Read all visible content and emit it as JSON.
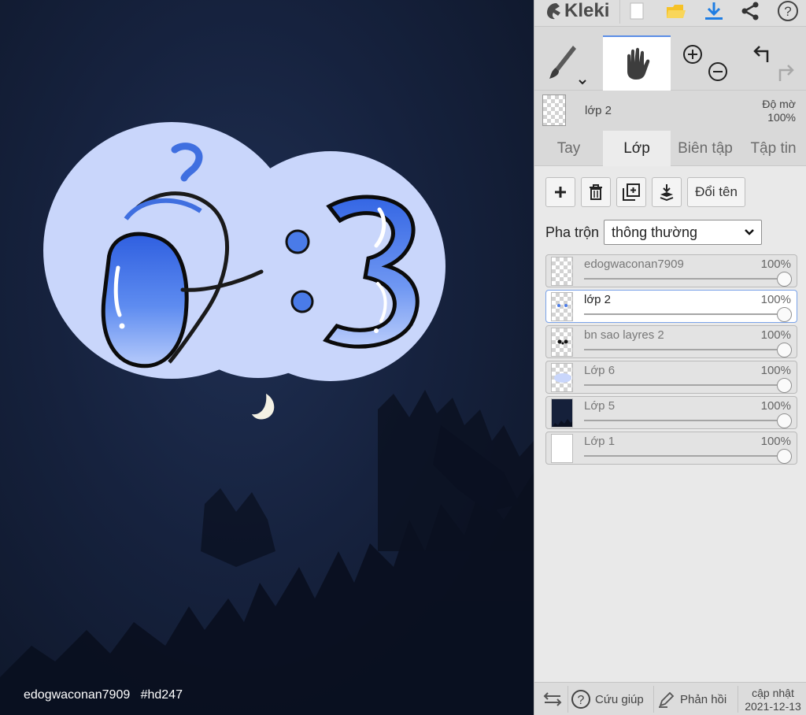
{
  "app": {
    "name": "Kleki"
  },
  "topbar": {
    "icons": [
      "new-file-icon",
      "open-folder-icon",
      "download-icon",
      "share-icon",
      "help-icon"
    ]
  },
  "tools": [
    "brush-tool-icon",
    "hand-tool-icon",
    "zoom-in-icon",
    "zoom-out-icon",
    "undo-icon",
    "redo-icon"
  ],
  "layer_info": {
    "name": "lớp 2",
    "opacity_label": "Độ mờ",
    "opacity_value": "100%"
  },
  "tabs": [
    {
      "label": "Tay",
      "active": false
    },
    {
      "label": "Lớp",
      "active": true
    },
    {
      "label": "Biên tập",
      "active": false
    },
    {
      "label": "Tập tin",
      "active": false
    }
  ],
  "layer_actions": {
    "add_icon": "plus-icon",
    "delete_icon": "trash-icon",
    "duplicate_icon": "duplicate-icon",
    "merge_icon": "merge-down-icon",
    "rename_label": "Đổi tên"
  },
  "blend": {
    "label": "Pha trộn",
    "value": "thông thường"
  },
  "layers": [
    {
      "name": "edogwaconan7909",
      "opacity": "100%",
      "opacity_value": 1.0,
      "selected": false
    },
    {
      "name": "lớp 2",
      "opacity": "100%",
      "opacity_value": 1.0,
      "selected": true
    },
    {
      "name": "bn sao layres 2",
      "opacity": "100%",
      "opacity_value": 1.0,
      "selected": false
    },
    {
      "name": "Lớp 6",
      "opacity": "100%",
      "opacity_value": 1.0,
      "selected": false
    },
    {
      "name": "Lớp 5",
      "opacity": "100%",
      "opacity_value": 1.0,
      "selected": false
    },
    {
      "name": "Lớp 1",
      "opacity": "100%",
      "opacity_value": 1.0,
      "selected": false
    }
  ],
  "footer": {
    "swap_icon": "swap-icon",
    "help_label": "Cứu giúp",
    "feedback_label": "Phản hồi",
    "update_label": "cập nhật",
    "update_date": "2021-12-13"
  },
  "canvas": {
    "watermark": "edogwaconan7909   #hd247",
    "sticker_text_left": "Ở",
    "sticker_text_right": ":3"
  },
  "colors": {
    "accent": "#5b8ee6",
    "sticker_bg": "#c9d6fb",
    "sticker_blue": "#3f6fe0",
    "sky": "#16223e"
  }
}
